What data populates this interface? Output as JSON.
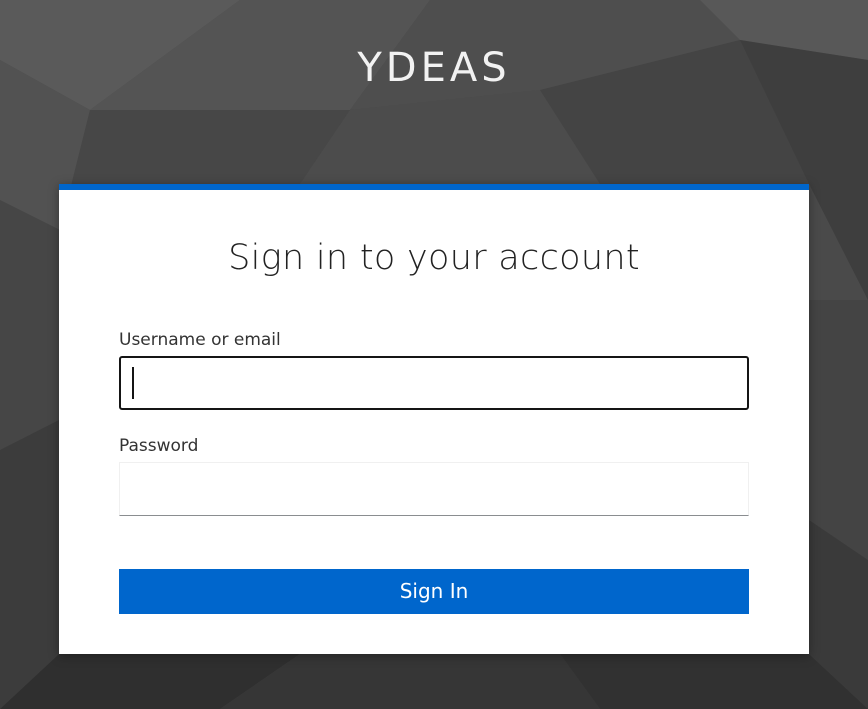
{
  "brand": {
    "name": "YDEAS"
  },
  "login": {
    "title": "Sign in to your account",
    "username_label": "Username or email",
    "username_value": "",
    "password_label": "Password",
    "password_value": "",
    "submit_label": "Sign In"
  },
  "colors": {
    "accent": "#0066cc",
    "background": "#4a4a4a",
    "card": "#ffffff"
  }
}
